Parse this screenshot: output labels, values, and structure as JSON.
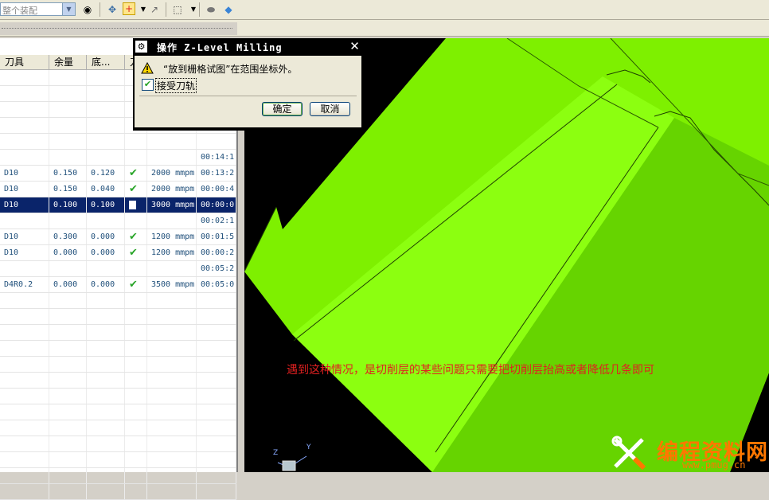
{
  "toolbar": {
    "combo_value": "整个装配",
    "icons": [
      "eye-filter-icon",
      "snap-icon",
      "point-icon",
      "move-icon",
      "selection-box-icon",
      "shaded-icon",
      "cube-view-icon"
    ]
  },
  "operation_table": {
    "columns": [
      "刀具",
      "余量",
      "底...",
      "刀"
    ],
    "rows": [
      {
        "tool": "",
        "stock": "",
        "floor": "",
        "status": "",
        "feed": "",
        "time": ""
      },
      {
        "tool": "",
        "stock": "",
        "floor": "",
        "status": "",
        "feed": "",
        "time": ""
      },
      {
        "tool": "",
        "stock": "",
        "floor": "",
        "status": "",
        "feed": "",
        "time": ""
      },
      {
        "tool": "",
        "stock": "",
        "floor": "",
        "status": "",
        "feed": "",
        "time": ""
      },
      {
        "tool": "",
        "stock": "",
        "floor": "",
        "status": "",
        "feed": "",
        "time": ""
      },
      {
        "tool": "",
        "stock": "",
        "floor": "",
        "status": "",
        "feed": "",
        "time": "00:14:1"
      },
      {
        "tool": "D10",
        "stock": "0.150",
        "floor": "0.120",
        "status": "check",
        "feed": "2000 mmpm",
        "time": "00:13:2"
      },
      {
        "tool": "D10",
        "stock": "0.150",
        "floor": "0.040",
        "status": "check",
        "feed": "2000 mmpm",
        "time": "00:00:4"
      },
      {
        "tool": "D10",
        "stock": "0.100",
        "floor": "0.100",
        "status": "box",
        "feed": "3000 mmpm",
        "time": "00:00:0"
      },
      {
        "tool": "",
        "stock": "",
        "floor": "",
        "status": "",
        "feed": "",
        "time": "00:02:1"
      },
      {
        "tool": "D10",
        "stock": "0.300",
        "floor": "0.000",
        "status": "check",
        "feed": "1200 mmpm",
        "time": "00:01:5"
      },
      {
        "tool": "D10",
        "stock": "0.000",
        "floor": "0.000",
        "status": "check",
        "feed": "1200 mmpm",
        "time": "00:00:2"
      },
      {
        "tool": "",
        "stock": "",
        "floor": "",
        "status": "",
        "feed": "",
        "time": "00:05:2"
      },
      {
        "tool": "D4R0.2",
        "stock": "0.000",
        "floor": "0.000",
        "status": "check",
        "feed": "3500 mmpm",
        "time": "00:05:0"
      }
    ],
    "selected_row": 8,
    "empty_rows": 13
  },
  "dialog": {
    "title": "操作  Z-Level Milling",
    "close": "✕",
    "message": "“放到栅格试图”在范围坐标外。",
    "checkbox_label": "接受刀轨",
    "checkbox_checked": true,
    "ok_label": "确定",
    "cancel_label": "取消"
  },
  "viewport": {
    "annotation": "遇到这种情况，是切削层的某些问题只需要把切削层抬高或者降低几条即可",
    "model_color": "#80ff00",
    "axis_labels": {
      "z": "Z",
      "y": "Y"
    }
  },
  "watermark": {
    "title": "编程资料网",
    "url": "www.pmug.cn"
  }
}
